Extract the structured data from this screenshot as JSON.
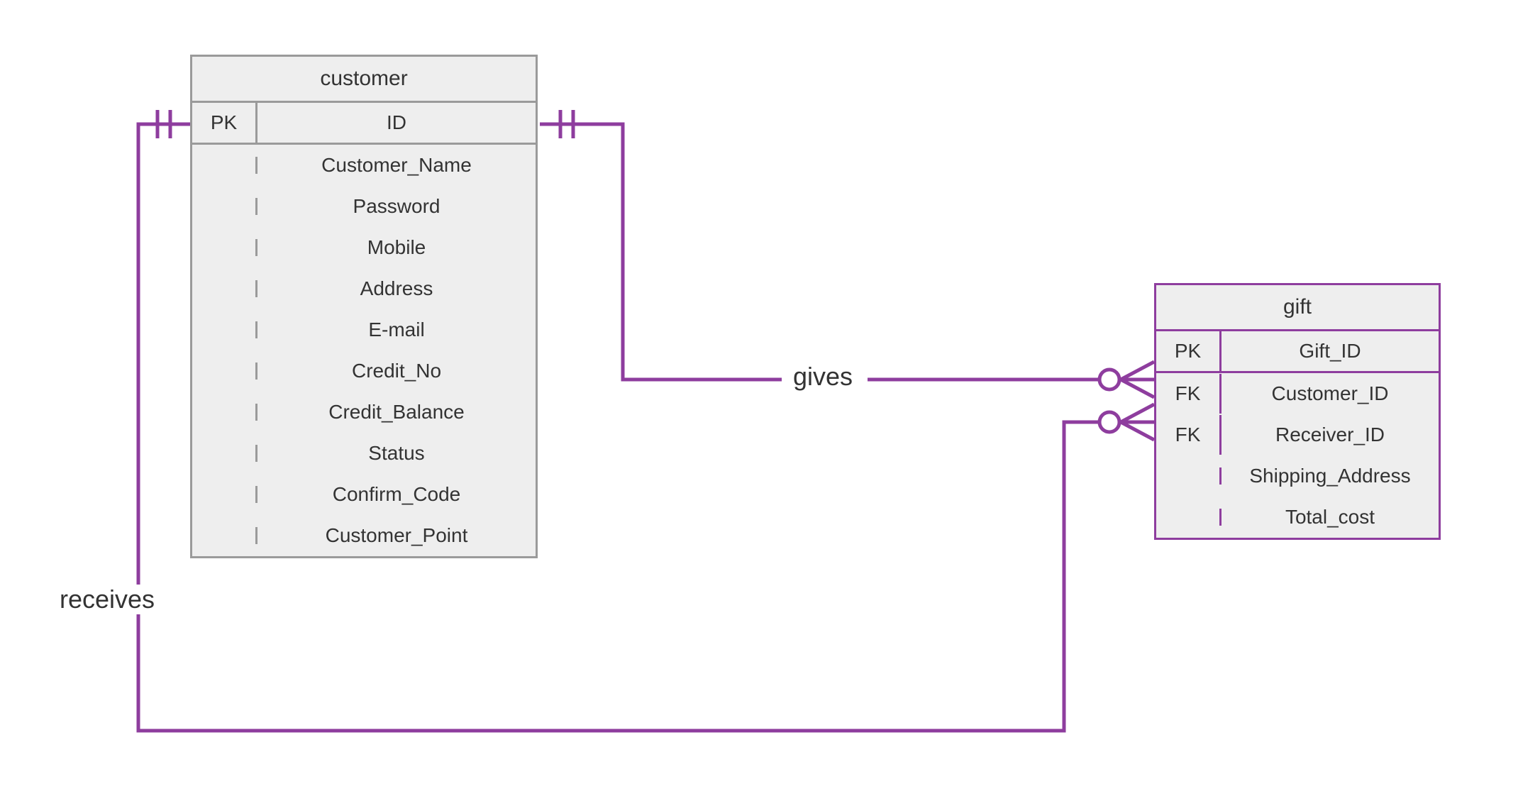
{
  "entities": {
    "customer": {
      "title": "customer",
      "rows": [
        {
          "key": "PK",
          "attr": "ID"
        },
        {
          "key": "",
          "attr": "Customer_Name"
        },
        {
          "key": "",
          "attr": "Password"
        },
        {
          "key": "",
          "attr": "Mobile"
        },
        {
          "key": "",
          "attr": "Address"
        },
        {
          "key": "",
          "attr": "E-mail"
        },
        {
          "key": "",
          "attr": "Credit_No"
        },
        {
          "key": "",
          "attr": "Credit_Balance"
        },
        {
          "key": "",
          "attr": "Status"
        },
        {
          "key": "",
          "attr": "Confirm_Code"
        },
        {
          "key": "",
          "attr": "Customer_Point"
        }
      ]
    },
    "gift": {
      "title": "gift",
      "rows": [
        {
          "key": "PK",
          "attr": "Gift_ID"
        },
        {
          "key": "FK",
          "attr": "Customer_ID"
        },
        {
          "key": "FK",
          "attr": "Receiver_ID"
        },
        {
          "key": "",
          "attr": "Shipping_Address"
        },
        {
          "key": "",
          "attr": "Total_cost"
        }
      ]
    }
  },
  "relationships": {
    "gives": {
      "label": "gives",
      "from": "customer",
      "to": "gift",
      "from_card": "one",
      "to_card": "zero_or_many"
    },
    "receives": {
      "label": "receives",
      "from": "customer",
      "to": "gift",
      "from_card": "one",
      "to_card": "zero_or_many"
    }
  },
  "chart_data": {
    "type": "er_diagram",
    "entities": [
      {
        "name": "customer",
        "attributes": [
          {
            "name": "ID",
            "key": "PK"
          },
          {
            "name": "Customer_Name"
          },
          {
            "name": "Password"
          },
          {
            "name": "Mobile"
          },
          {
            "name": "Address"
          },
          {
            "name": "E-mail"
          },
          {
            "name": "Credit_No"
          },
          {
            "name": "Credit_Balance"
          },
          {
            "name": "Status"
          },
          {
            "name": "Confirm_Code"
          },
          {
            "name": "Customer_Point"
          }
        ]
      },
      {
        "name": "gift",
        "attributes": [
          {
            "name": "Gift_ID",
            "key": "PK"
          },
          {
            "name": "Customer_ID",
            "key": "FK"
          },
          {
            "name": "Receiver_ID",
            "key": "FK"
          },
          {
            "name": "Shipping_Address"
          },
          {
            "name": "Total_cost"
          }
        ]
      }
    ],
    "relationships": [
      {
        "name": "gives",
        "from": "customer",
        "to": "gift",
        "from_cardinality": "exactly_one",
        "to_cardinality": "zero_or_many"
      },
      {
        "name": "receives",
        "from": "customer",
        "to": "gift",
        "from_cardinality": "exactly_one",
        "to_cardinality": "zero_or_many"
      }
    ]
  }
}
